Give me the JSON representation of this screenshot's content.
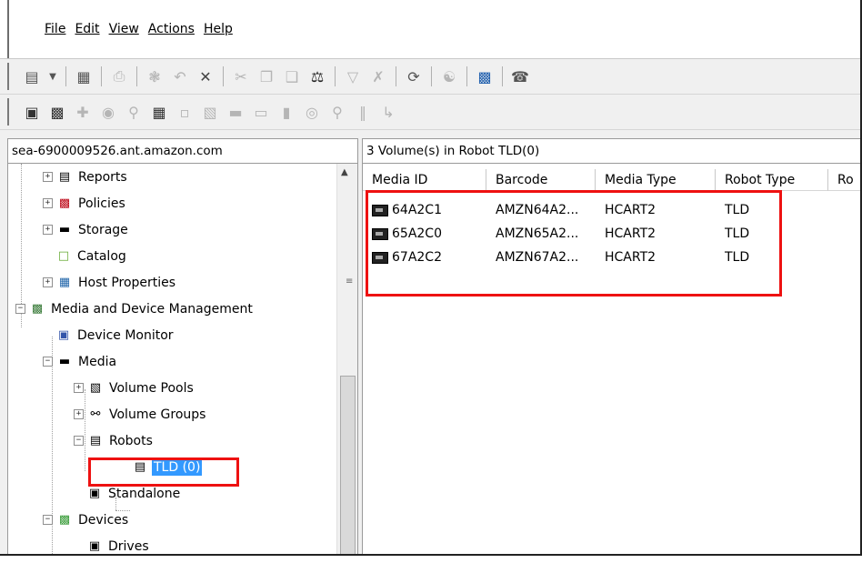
{
  "menu": {
    "items": [
      {
        "label": "File"
      },
      {
        "label": "Edit"
      },
      {
        "label": "View"
      },
      {
        "label": "Actions"
      },
      {
        "label": "Help"
      }
    ]
  },
  "toolbar1": {
    "icons": [
      "new-icon",
      "dropdown-arrow-icon",
      "preview-icon",
      "print-icon",
      "settings-icon",
      "undo-icon",
      "delete-icon",
      "cut-icon",
      "copy-icon",
      "paste-icon",
      "find-icon",
      "filter-icon",
      "clear-filter-icon",
      "refresh-icon",
      "options-icon",
      "devices-icon",
      "help-icon"
    ]
  },
  "toolbar2": {
    "icons": [
      "add-device-icon",
      "configure-icon",
      "move-icon",
      "eject-icon",
      "inventory-icon",
      "label-icon",
      "erase-icon",
      "clean-icon",
      "up-icon",
      "down-icon",
      "freeze-icon",
      "unfreeze-icon",
      "suspend-icon",
      "lock-icon",
      "unlock-icon"
    ]
  },
  "left_pane": {
    "header": "sea-6900009526.ant.amazon.com",
    "tree": [
      {
        "label": "Reports",
        "icon": "report-icon"
      },
      {
        "label": "Policies",
        "icon": "policy-icon"
      },
      {
        "label": "Storage",
        "icon": "storage-icon"
      },
      {
        "label": "Catalog",
        "icon": "catalog-icon"
      },
      {
        "label": "Host Properties",
        "icon": "host-properties-icon"
      },
      {
        "label": "Media and Device Management",
        "icon": "media-device-icon"
      },
      {
        "label": "Device Monitor",
        "icon": "monitor-icon"
      },
      {
        "label": "Media",
        "icon": "media-icon"
      },
      {
        "label": "Volume Pools",
        "icon": "volume-pools-icon"
      },
      {
        "label": "Volume Groups",
        "icon": "volume-groups-icon"
      },
      {
        "label": "Robots",
        "icon": "robot-icon"
      },
      {
        "label": "TLD (0)",
        "icon": "robot-icon"
      },
      {
        "label": "Standalone",
        "icon": "standalone-icon"
      },
      {
        "label": "Devices",
        "icon": "devices-icon"
      },
      {
        "label": "Drives",
        "icon": "drives-icon"
      }
    ]
  },
  "right_pane": {
    "header": "3 Volume(s) in Robot TLD(0)",
    "columns": [
      "Media ID",
      "Barcode",
      "Media Type",
      "Robot Type",
      "Ro"
    ],
    "rows": [
      {
        "media_id": "64A2C1",
        "barcode": "AMZN64A2...",
        "media_type": "HCART2",
        "robot_type": "TLD"
      },
      {
        "media_id": "65A2C0",
        "barcode": "AMZN65A2...",
        "media_type": "HCART2",
        "robot_type": "TLD"
      },
      {
        "media_id": "67A2C2",
        "barcode": "AMZN67A2...",
        "media_type": "HCART2",
        "robot_type": "TLD"
      }
    ]
  },
  "colors": {
    "highlight": "#ee1111",
    "selection": "#3399ff"
  }
}
